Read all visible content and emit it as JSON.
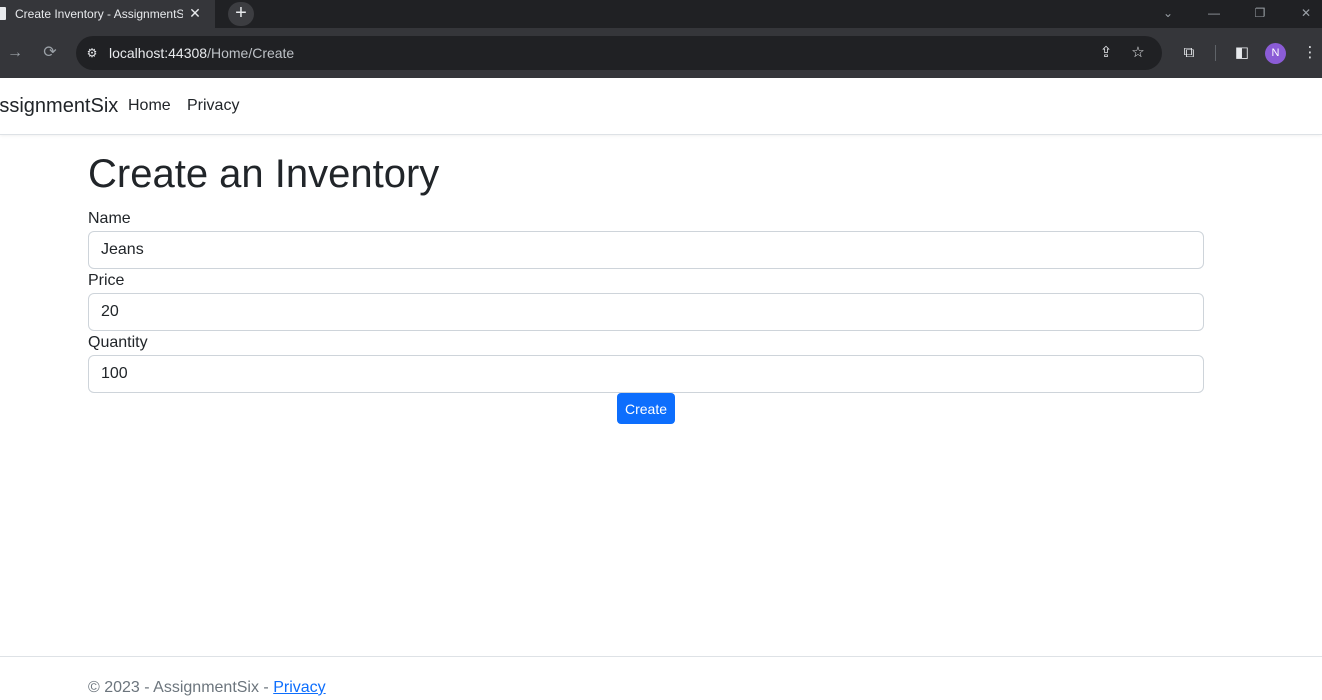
{
  "browser": {
    "tab_title": "Create Inventory - AssignmentSix",
    "tab_close": "✕",
    "new_tab": "+",
    "url_host": "localhost:44308",
    "url_path": "/Home/Create",
    "avatar_initial": "N"
  },
  "icons": {
    "back": "←",
    "forward": "→",
    "reload": "⟳",
    "site_info": "⚙",
    "share": "⇪",
    "bookmark": "☆",
    "extensions": "⧉",
    "sidepanel": "◧",
    "menu": "⋮",
    "tab_search": "⌄",
    "minimize": "—",
    "restore": "❐",
    "window_close": "✕"
  },
  "navbar": {
    "brand": "AssignmentSix",
    "links": [
      "Home",
      "Privacy"
    ]
  },
  "form": {
    "title": "Create an Inventory",
    "fields": [
      {
        "label": "Name",
        "value": "Jeans"
      },
      {
        "label": "Price",
        "value": "20"
      },
      {
        "label": "Quantity",
        "value": "100"
      }
    ],
    "submit_label": "Create"
  },
  "footer": {
    "text": "© 2023 - AssignmentSix - ",
    "link": "Privacy"
  },
  "colors": {
    "primary": "#0d6efd",
    "chrome_dark": "#202124",
    "chrome_toolbar": "#35363a",
    "avatar": "#8b5cd6"
  }
}
